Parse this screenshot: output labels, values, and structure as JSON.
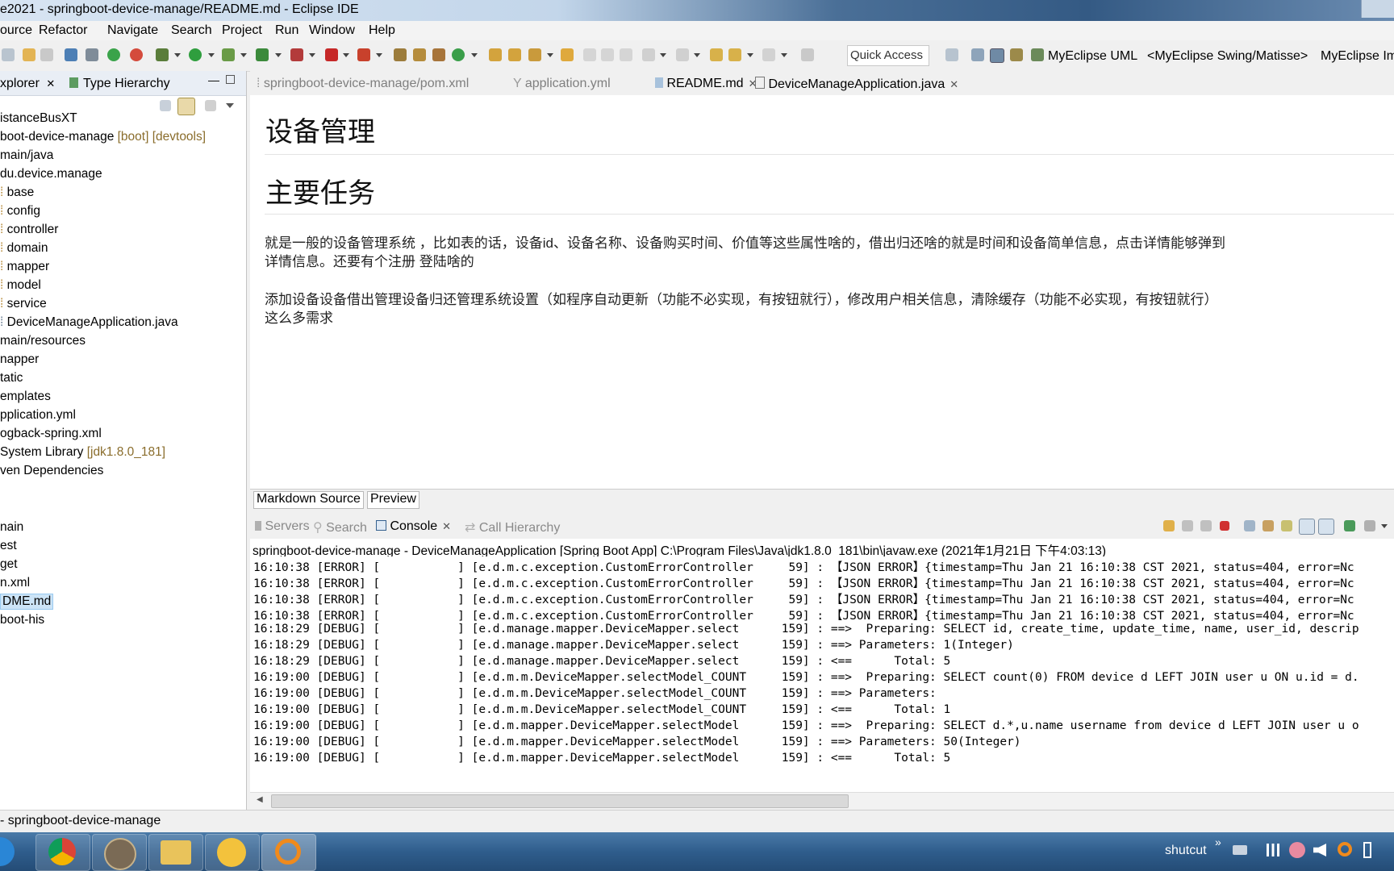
{
  "window": {
    "title": "e2021 - springboot-device-manage/README.md - Eclipse IDE"
  },
  "menubar": [
    "ource",
    "Refactor",
    "Navigate",
    "Search",
    "Project",
    "Run",
    "Window",
    "Help"
  ],
  "toolbar": {
    "quick_access_placeholder": "Quick Access",
    "perspectives": [
      "MyEclipse UML",
      "<MyEclipse Swing/Matisse>",
      "MyEclipse Im"
    ]
  },
  "left_panel": {
    "tabs": [
      {
        "label": "xplorer",
        "close": "✕"
      },
      {
        "label": "Type Hierarchy"
      }
    ],
    "tree": [
      {
        "label": "istanceBusXT",
        "decor": ""
      },
      {
        "label": "boot-device-manage",
        "decor": "[boot] [devtools]"
      },
      {
        "label": "main/java",
        "decor": ""
      },
      {
        "label": "du.device.manage",
        "decor": ""
      },
      {
        "label": "base",
        "decor": ""
      },
      {
        "label": "config",
        "decor": ""
      },
      {
        "label": "controller",
        "decor": ""
      },
      {
        "label": "domain",
        "decor": ""
      },
      {
        "label": "mapper",
        "decor": ""
      },
      {
        "label": "model",
        "decor": ""
      },
      {
        "label": "service",
        "decor": ""
      },
      {
        "label": "DeviceManageApplication.java",
        "decor": ""
      },
      {
        "label": "main/resources",
        "decor": ""
      },
      {
        "label": "napper",
        "decor": ""
      },
      {
        "label": "tatic",
        "decor": ""
      },
      {
        "label": "emplates",
        "decor": ""
      },
      {
        "label": "pplication.yml",
        "decor": ""
      },
      {
        "label": "ogback-spring.xml",
        "decor": ""
      },
      {
        "label": "System Library",
        "decor": "[jdk1.8.0_181]"
      },
      {
        "label": "ven Dependencies",
        "decor": ""
      },
      {
        "label": "nain",
        "decor": ""
      },
      {
        "label": "est",
        "decor": ""
      },
      {
        "label": "get",
        "decor": ""
      },
      {
        "label": "n.xml",
        "decor": ""
      },
      {
        "label": "DME.md",
        "decor": ""
      },
      {
        "label": "boot-his",
        "decor": ""
      }
    ]
  },
  "editor_tabs": [
    {
      "label": "springboot-device-manage/pom.xml"
    },
    {
      "label": "application.yml"
    },
    {
      "label": "README.md",
      "close": "✕"
    },
    {
      "label": "DeviceManageApplication.java",
      "close": "✕"
    }
  ],
  "readme": {
    "h1": "设备管理",
    "h2": "主要任务",
    "p1_line1": "就是一般的设备管理系统 ，比如表的话，设备id、设备名称、设备购买时间、价值等这些属性啥的，借出归还啥的就是时间和设备简单信息，点击详情能够弹到",
    "p1_line2": "详情信息。还要有个注册 登陆啥的",
    "p2_line1": "添加设备设备借出管理设备归还管理系统设置（如程序自动更新（功能不必实现，有按钮就行），修改用户相关信息，清除缓存（功能不必实现，有按钮就行）",
    "p2_line2": "这么多需求"
  },
  "md_tabs": [
    "Markdown Source",
    "Preview"
  ],
  "console_tabs": [
    {
      "label": "Servers"
    },
    {
      "label": "Search"
    },
    {
      "label": "Console",
      "close": "✕"
    },
    {
      "label": "Call Hierarchy"
    }
  ],
  "console": {
    "header": "springboot-device-manage - DeviceManageApplication [Spring Boot App] C:\\Program Files\\Java\\jdk1.8.0_181\\bin\\javaw.exe (2021年1月21日 下午4:03:13)",
    "lines": [
      "16:10:38 [ERROR] [           ] [e.d.m.c.exception.CustomErrorController     59] : 【JSON ERROR】{timestamp=Thu Jan 21 16:10:38 CST 2021, status=404, error=Nc",
      "16:10:38 [ERROR] [           ] [e.d.m.c.exception.CustomErrorController     59] : 【JSON ERROR】{timestamp=Thu Jan 21 16:10:38 CST 2021, status=404, error=Nc",
      "16:10:38 [ERROR] [           ] [e.d.m.c.exception.CustomErrorController     59] : 【JSON ERROR】{timestamp=Thu Jan 21 16:10:38 CST 2021, status=404, error=Nc",
      "16:10:38 [ERROR] [           ] [e.d.m.c.exception.CustomErrorController     59] : 【JSON ERROR】{timestamp=Thu Jan 21 16:10:38 CST 2021, status=404, error=Nc",
      "16:18:29 [DEBUG] [           ] [e.d.manage.mapper.DeviceMapper.select      159] : ==>  Preparing: SELECT id, create_time, update_time, name, user_id, descrip",
      "16:18:29 [DEBUG] [           ] [e.d.manage.mapper.DeviceMapper.select      159] : ==> Parameters: 1(Integer)",
      "16:18:29 [DEBUG] [           ] [e.d.manage.mapper.DeviceMapper.select      159] : <==      Total: 5",
      "16:19:00 [DEBUG] [           ] [e.d.m.m.DeviceMapper.selectModel_COUNT     159] : ==>  Preparing: SELECT count(0) FROM device d LEFT JOIN user u ON u.id = d.",
      "16:19:00 [DEBUG] [           ] [e.d.m.m.DeviceMapper.selectModel_COUNT     159] : ==> Parameters: ",
      "16:19:00 [DEBUG] [           ] [e.d.m.m.DeviceMapper.selectModel_COUNT     159] : <==      Total: 1",
      "16:19:00 [DEBUG] [           ] [e.d.m.mapper.DeviceMapper.selectModel      159] : ==>  Preparing: SELECT d.*,u.name username from device d LEFT JOIN user u o",
      "16:19:00 [DEBUG] [           ] [e.d.m.mapper.DeviceMapper.selectModel      159] : ==> Parameters: 50(Integer)",
      "16:19:00 [DEBUG] [           ] [e.d.m.mapper.DeviceMapper.selectModel      159] : <==      Total: 5"
    ]
  },
  "status_bar": {
    "text": "- springboot-device-manage"
  },
  "taskbar": {
    "tray_label": "shutcut",
    "tray_chevron": "»"
  }
}
